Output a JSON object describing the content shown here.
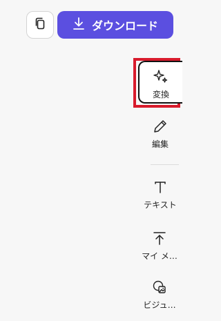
{
  "header": {
    "download_label": "ダウンロード",
    "copy_icon": "copy-icon",
    "download_icon": "download-icon",
    "download_color": "#5b4fe0"
  },
  "tools": [
    {
      "label": "変換",
      "icon": "sparkles-icon",
      "active": true
    },
    {
      "label": "編集",
      "icon": "pencil-icon"
    },
    {
      "label": "テキスト",
      "icon": "text-icon"
    },
    {
      "label": "マイ メ…",
      "icon": "upload-icon"
    },
    {
      "label": "ビジュ…",
      "icon": "visual-icon"
    }
  ],
  "highlight_color": "#d81b2c"
}
